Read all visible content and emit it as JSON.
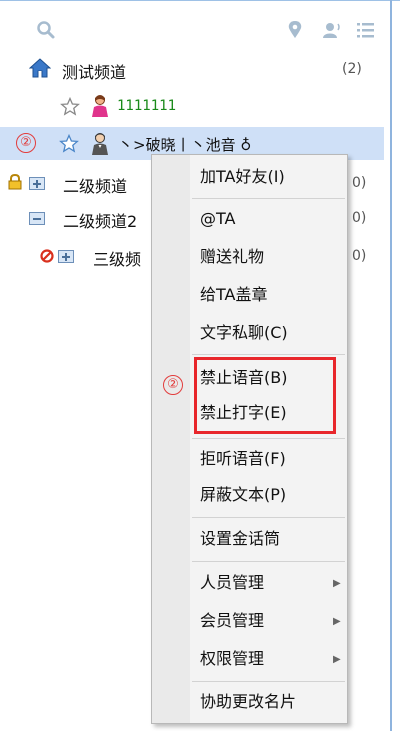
{
  "channels": {
    "root": {
      "name": "测试频道",
      "count": "(2)"
    },
    "user1": {
      "name": "1111111"
    },
    "user2": {
      "name": "丶>破晓丨丶池音 ♁"
    },
    "sub1": {
      "name": "二级频道",
      "count": "0)"
    },
    "sub2": {
      "name": "二级频道2",
      "count": "0)"
    },
    "sub3": {
      "name": "三级频",
      "count": "0)"
    }
  },
  "markers": {
    "row_marker": "②",
    "menu_marker": "②"
  },
  "menu": {
    "items": [
      {
        "label": "加TA好友(I)"
      },
      {
        "label": "@TA"
      },
      {
        "label": "赠送礼物"
      },
      {
        "label": "给TA盖章"
      },
      {
        "label": "文字私聊(C)"
      },
      {
        "label": "禁止语音(B)"
      },
      {
        "label": "禁止打字(E)"
      },
      {
        "label": "拒听语音(F)"
      },
      {
        "label": "屏蔽文本(P)"
      },
      {
        "label": "设置金话筒"
      },
      {
        "label": "人员管理"
      },
      {
        "label": "会员管理"
      },
      {
        "label": "权限管理"
      },
      {
        "label": "协助更改名片"
      }
    ]
  },
  "colors": {
    "selection": "#cfe0f7",
    "highlight": "#e8262b",
    "user_green": "#1a8a1a"
  }
}
